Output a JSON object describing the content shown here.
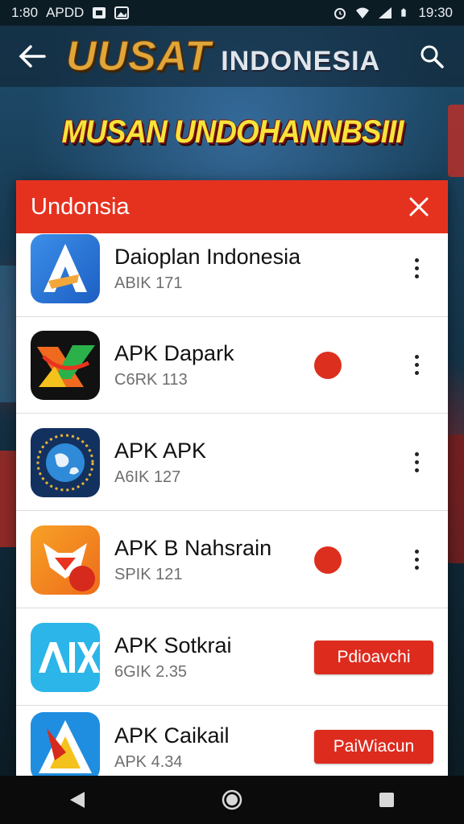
{
  "status_bar": {
    "left_time": "1:80",
    "left_label": "APDD",
    "right_time": "19:30"
  },
  "app_bar": {
    "title_part1": "UUSAT",
    "title_part2": "INDONESIA"
  },
  "banner": {
    "text": "MUSAN UNDOHANNBSIII"
  },
  "dialog": {
    "title": "Undonsia",
    "items": [
      {
        "name": "Daioplan Indonesia",
        "size": "ABIK 171",
        "badge": false,
        "action": "more",
        "icon": "blue-triangle-app-icon"
      },
      {
        "name": "APK Dapark",
        "size": "C6RK 113",
        "badge": true,
        "action": "more",
        "icon": "orange-green-x-app-icon"
      },
      {
        "name": "APK APK",
        "size": "A6IK 127",
        "badge": false,
        "action": "more",
        "icon": "globe-app-icon"
      },
      {
        "name": "APK B Nahsrain",
        "size": "SPIK 121",
        "badge": true,
        "action": "more",
        "icon": "fox-app-icon"
      },
      {
        "name": "APK Sotkrai",
        "size": "6GIK 2.35",
        "badge": false,
        "action": "Pdioavchi",
        "icon": "aix-app-icon"
      },
      {
        "name": "APK Caikail",
        "size": "APK 4.34",
        "badge": false,
        "action": "PaiWiacun",
        "icon": "red-yellow-triangle-app-icon"
      }
    ]
  },
  "colors": {
    "accent": "#e5321f",
    "badge": "#dc2f1e",
    "title_gold": "#e0a63a",
    "banner_yellow": "#f6e43a"
  },
  "icons": {
    "back": "arrow-back-icon",
    "search": "search-icon",
    "close": "close-icon",
    "more": "more-vert-icon",
    "nav_back": "nav-back-icon",
    "nav_home": "nav-home-icon",
    "nav_recents": "nav-recents-icon"
  }
}
